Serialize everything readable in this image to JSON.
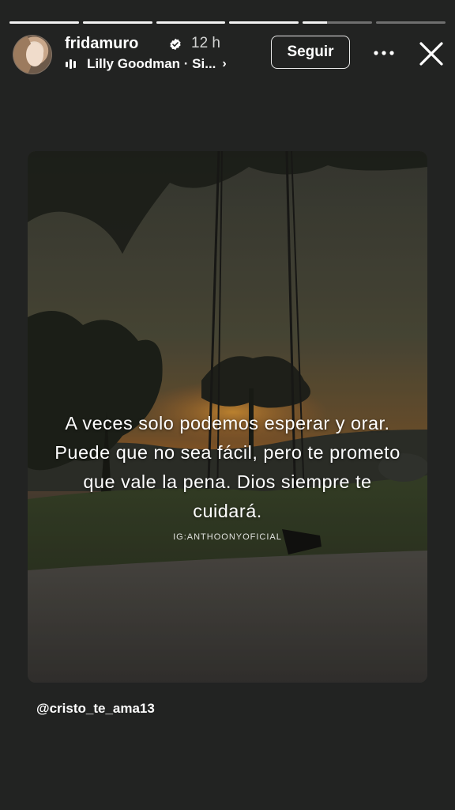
{
  "progress": {
    "segments": [
      {
        "fill": 1.0
      },
      {
        "fill": 1.0
      },
      {
        "fill": 1.0
      },
      {
        "fill": 1.0
      },
      {
        "fill": 0.35
      },
      {
        "fill": 0.0
      }
    ]
  },
  "header": {
    "username": "fridamuro",
    "time": "12 h",
    "music_text": "Lilly Goodman · Si...",
    "music_chevron": "›",
    "follow_label": "Seguir",
    "more_icon": "more-dots-icon",
    "close_icon": "close-icon",
    "verified_icon": "verified-badge-icon"
  },
  "post": {
    "quote": "A veces solo podemos esperar y orar. Puede que no sea fácil, pero te prometo que vale la pena. Dios siempre te cuidará.",
    "watermark": "IG:ANTHOONYOFICIAL"
  },
  "mention": "@cristo_te_ama13",
  "colors": {
    "background": "#222322",
    "text": "#ffffff",
    "sky_top": "#4b4d44",
    "sunset": "#c97a24"
  }
}
